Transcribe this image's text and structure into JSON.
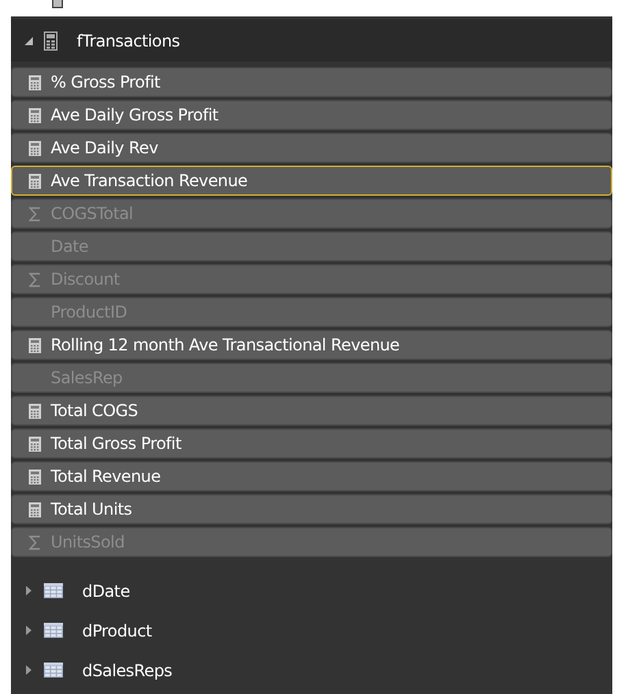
{
  "tables": [
    {
      "name": "fTransactions",
      "expanded": true,
      "fields": [
        {
          "name": "% Gross Profit",
          "kind": "measure",
          "hidden": false,
          "selected": false
        },
        {
          "name": "Ave Daily Gross Profit",
          "kind": "measure",
          "hidden": false,
          "selected": false
        },
        {
          "name": "Ave Daily Rev",
          "kind": "measure",
          "hidden": false,
          "selected": false
        },
        {
          "name": "Ave Transaction Revenue",
          "kind": "measure",
          "hidden": false,
          "selected": true
        },
        {
          "name": "COGSTotal",
          "kind": "sum",
          "hidden": true,
          "selected": false
        },
        {
          "name": "Date",
          "kind": "field",
          "hidden": true,
          "selected": false
        },
        {
          "name": "Discount",
          "kind": "sum",
          "hidden": true,
          "selected": false
        },
        {
          "name": "ProductID",
          "kind": "field",
          "hidden": true,
          "selected": false
        },
        {
          "name": "Rolling 12 month Ave Transactional Revenue",
          "kind": "measure",
          "hidden": false,
          "selected": false
        },
        {
          "name": "SalesRep",
          "kind": "field",
          "hidden": true,
          "selected": false
        },
        {
          "name": "Total COGS",
          "kind": "measure",
          "hidden": false,
          "selected": false
        },
        {
          "name": "Total Gross Profit",
          "kind": "measure",
          "hidden": false,
          "selected": false
        },
        {
          "name": "Total Revenue",
          "kind": "measure",
          "hidden": false,
          "selected": false
        },
        {
          "name": "Total Units",
          "kind": "measure",
          "hidden": false,
          "selected": false
        },
        {
          "name": "UnitsSold",
          "kind": "sum",
          "hidden": true,
          "selected": false
        }
      ]
    },
    {
      "name": "dDate",
      "expanded": false
    },
    {
      "name": "dProduct",
      "expanded": false
    },
    {
      "name": "dSalesReps",
      "expanded": false
    }
  ]
}
